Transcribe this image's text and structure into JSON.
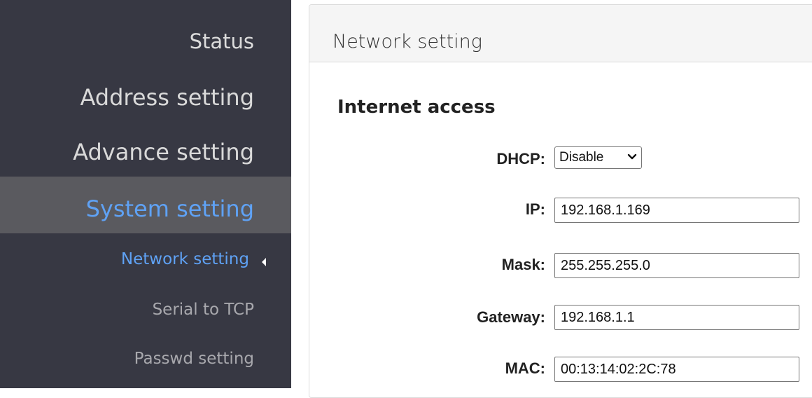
{
  "sidebar": {
    "items": [
      {
        "label": "Status"
      },
      {
        "label": "Address setting"
      },
      {
        "label": "Advance setting"
      },
      {
        "label": "System setting"
      }
    ],
    "subitems": [
      {
        "label": "Network setting"
      },
      {
        "label": "Serial to TCP"
      },
      {
        "label": "Passwd setting"
      }
    ]
  },
  "panel": {
    "title": "Network setting",
    "section_title": "Internet access",
    "dhcp": {
      "label": "DHCP:",
      "value": "Disable"
    },
    "ip": {
      "label": "IP:",
      "value": "192.168.1.169"
    },
    "mask": {
      "label": "Mask:",
      "value": "255.255.255.0"
    },
    "gateway": {
      "label": "Gateway:",
      "value": "192.168.1.1"
    },
    "mac": {
      "label": "MAC:",
      "value": "00:13:14:02:2C:78"
    }
  },
  "colors": {
    "sidebar_bg": "#373843",
    "active_bg": "#5a5a5f",
    "accent": "#5fa2f5"
  }
}
